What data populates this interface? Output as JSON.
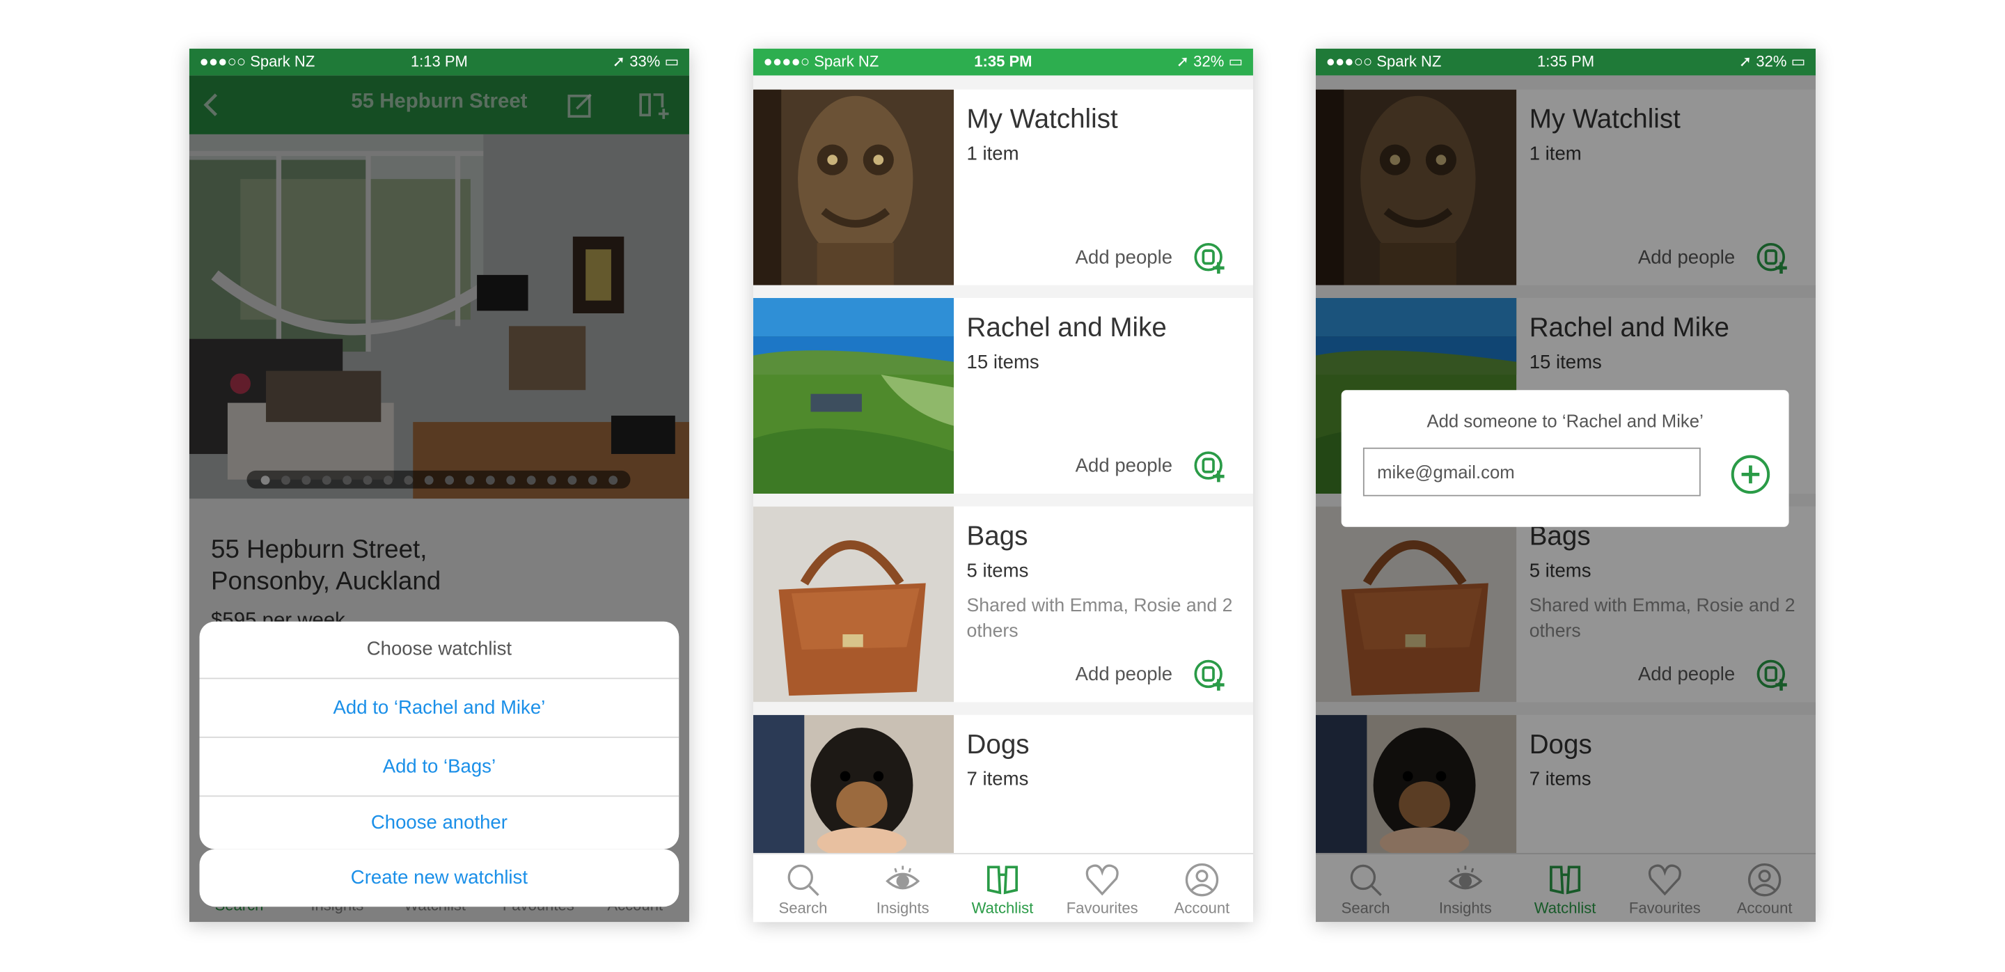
{
  "phone1": {
    "status": {
      "carrier": "●●●○○ Spark NZ",
      "time": "1:13 PM",
      "battery": "33%"
    },
    "nav_title": "55 Hepburn Street",
    "address_line1": "55 Hepburn Street,",
    "address_line2": "Ponsonby, Auckland",
    "price": "$595 per week",
    "sheet": {
      "title": "Choose watchlist",
      "options": [
        "Add to ‘Rachel and Mike’",
        "Add to ‘Bags’",
        "Choose another"
      ],
      "create": "Create new watchlist"
    },
    "tabs": [
      "Search",
      "Insights",
      "Watchlist",
      "Favourites",
      "Account"
    ]
  },
  "phone2": {
    "status": {
      "carrier": "●●●●○ Spark NZ",
      "time": "1:35 PM",
      "battery": "32%"
    }
  },
  "phone3": {
    "status": {
      "carrier": "●●●○○ Spark NZ",
      "time": "1:35 PM",
      "battery": "32%"
    },
    "popup_title": "Add someone to ‘Rachel and Mike’",
    "popup_input": "mike@gmail.com"
  },
  "watchlists": [
    {
      "name": "My Watchlist",
      "count": "1 item",
      "shared": "",
      "add_people": "Add people"
    },
    {
      "name": "Rachel and Mike",
      "count": "15 items",
      "shared": "",
      "add_people": "Add people"
    },
    {
      "name": "Bags",
      "count": "5 items",
      "shared": "Shared with Emma, Rosie and 2 others",
      "add_people": "Add people"
    },
    {
      "name": "Dogs",
      "count": "7 items",
      "shared": "",
      "add_people": ""
    }
  ],
  "tabs": [
    {
      "label": "Search",
      "icon": "search-icon"
    },
    {
      "label": "Insights",
      "icon": "eye-icon"
    },
    {
      "label": "Watchlist",
      "icon": "binoculars-icon"
    },
    {
      "label": "Favourites",
      "icon": "heart-icon"
    },
    {
      "label": "Account",
      "icon": "account-icon"
    }
  ],
  "colors": {
    "brand_green": "#2a9b47",
    "link_blue": "#1a8fe8"
  }
}
